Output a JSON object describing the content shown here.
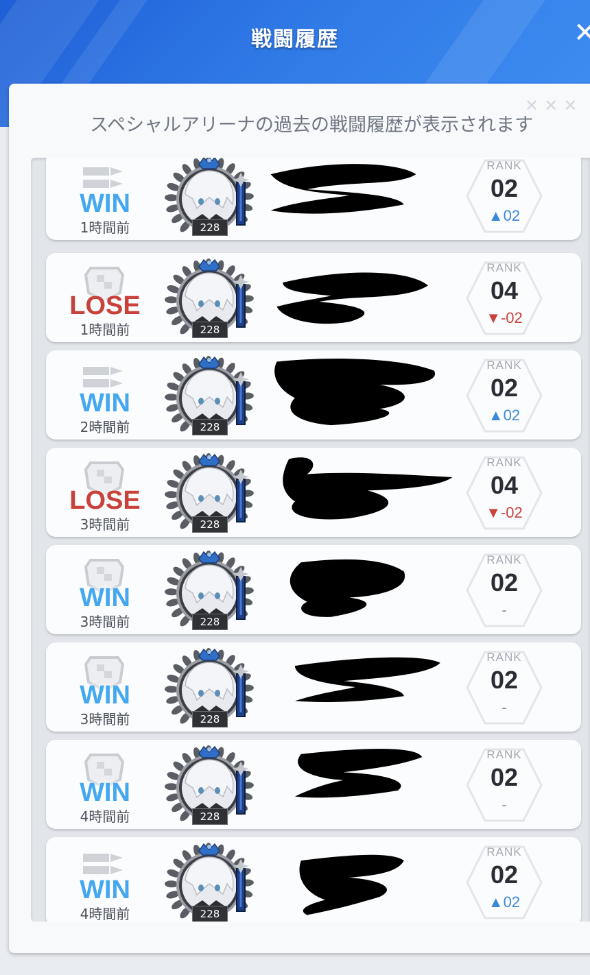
{
  "header": {
    "title": "戦闘履歴",
    "close_glyph": "✕"
  },
  "panel": {
    "subtitle": "スペシャルアリーナの過去の戦闘履歴が表示されます",
    "decoration": "✕✕✕"
  },
  "colors": {
    "header_blue": "#2f79e6",
    "win": "#44a8f0",
    "lose": "#c8413a",
    "rank_up": "#3b87d8",
    "rank_down": "#c8413a"
  },
  "battles": [
    {
      "result": "WIN",
      "time": "1時間前",
      "icon": "bullets-icon",
      "level": "228",
      "rank_label": "RANK",
      "rank": "02",
      "change": "▲02",
      "change_dir": "up"
    },
    {
      "result": "LOSE",
      "time": "1時間前",
      "icon": "shield-icon",
      "level": "228",
      "rank_label": "RANK",
      "rank": "04",
      "change": "▼-02",
      "change_dir": "down"
    },
    {
      "result": "WIN",
      "time": "2時間前",
      "icon": "bullets-icon",
      "level": "228",
      "rank_label": "RANK",
      "rank": "02",
      "change": "▲02",
      "change_dir": "up"
    },
    {
      "result": "LOSE",
      "time": "3時間前",
      "icon": "shield-icon",
      "level": "228",
      "rank_label": "RANK",
      "rank": "04",
      "change": "▼-02",
      "change_dir": "down"
    },
    {
      "result": "WIN",
      "time": "3時間前",
      "icon": "shield-icon",
      "level": "228",
      "rank_label": "RANK",
      "rank": "02",
      "change": "-",
      "change_dir": "none"
    },
    {
      "result": "WIN",
      "time": "3時間前",
      "icon": "shield-icon",
      "level": "228",
      "rank_label": "RANK",
      "rank": "02",
      "change": "-",
      "change_dir": "none"
    },
    {
      "result": "WIN",
      "time": "4時間前",
      "icon": "shield-icon",
      "level": "228",
      "rank_label": "RANK",
      "rank": "02",
      "change": "-",
      "change_dir": "none"
    },
    {
      "result": "WIN",
      "time": "4時間前",
      "icon": "bullets-icon",
      "level": "228",
      "rank_label": "RANK",
      "rank": "02",
      "change": "▲02",
      "change_dir": "up"
    }
  ]
}
